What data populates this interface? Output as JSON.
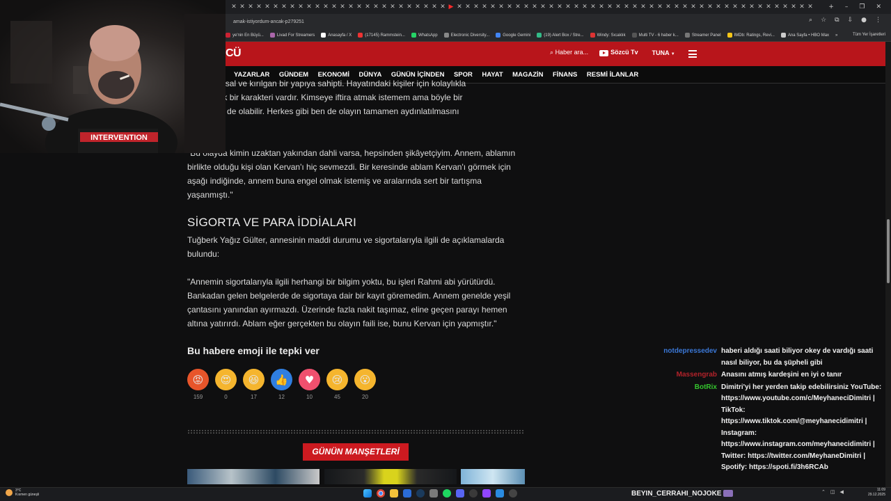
{
  "browser": {
    "url": "amak-istiyordum-ancak-p279251",
    "bookmarks": [
      {
        "label": "ye'nin En Büyü..."
      },
      {
        "label": "Livad For Streamers"
      },
      {
        "label": "Anasayfa / X"
      },
      {
        "label": "(17145) Rammstein..."
      },
      {
        "label": "WhatsApp"
      },
      {
        "label": "Electronic Diversity..."
      },
      {
        "label": "Google Gemini"
      },
      {
        "label": "(19) Alert Box / Stre..."
      },
      {
        "label": "Windy: Sıcaklık"
      },
      {
        "label": "Multi TV - 6 haber k..."
      },
      {
        "label": "Streamer Panel"
      },
      {
        "label": "IMDb: Ratings, Revi..."
      },
      {
        "label": "Ana Sayfa • HBO Max"
      }
    ],
    "bookmarks_more": "»",
    "all_bookmarks": "Tüm Yer İşaretleri",
    "new_tab": "+"
  },
  "site": {
    "logo": "CÜ",
    "search_placeholder": "Haber ara...",
    "tv_label": "Sözcü Tv",
    "user_label": "TUNA",
    "nav": [
      "YAZARLAR",
      "GÜNDEM",
      "EKONOMİ",
      "DÜNYA",
      "GÜNÜN İÇİNDEN",
      "SPOR",
      "HAYAT",
      "MAGAZİN",
      "FİNANS",
      "RESMİ İLANLAR"
    ]
  },
  "article": {
    "p1": "...duygusal ve kırılgan bir yapıya sahipti. Hayatındaki kişiler için kolaylıkla ...i girebilecek bir karakteri vardır. Kimseye iftira atmak istemem ama böyle bir ...bilecek biri de olabilir. Herkes gibi ben de olayın tamamen aydınlatılmasını",
    "p1_lines": [
      "duygusal ve kırılgan bir yapıya sahipti. Hayatındaki kişiler için kolaylıkla",
      "girebilecek bir karakteri vardır. Kimseye iftira atmak istemem ama böyle bir",
      "bilecek biri de olabilir. Herkes gibi ben de olayın tamamen aydınlatılmasını"
    ],
    "p2": "\"Bu olayda kimin uzaktan yakından dahli varsa, hepsinden şikâyetçiyim. Annem, ablamın birlikte olduğu kişi olan Kervan'ı hiç sevmezdi. Bir keresinde ablam Kervan'ı görmek için aşağı indiğinde, annem buna engel olmak istemiş ve aralarında sert bir tartışma yaşanmıştı.\"",
    "heading": "SİGORTA VE PARA İDDİALARI",
    "p3": "Tuğberk Yağız Gülter, annesinin maddi durumu ve sigortalarıyla ilgili de açıklamalarda bulundu:",
    "p4": "\"Annemin sigortalarıyla ilgili herhangi bir bilgim yoktu, bu işleri Rahmi abi yürütürdü. Bankadan gelen belgelerde de sigortaya dair bir kayıt göremedim. Annem genelde yeşil çantasını yanından ayırmazdı. Üzerinde fazla nakit taşımaz, eline geçen parayı hemen altına yatırırdı. Ablam eğer gerçekten bu olayın faili ise, bunu Kervan için yapmıştır.\""
  },
  "reactions": {
    "title": "Bu habere emoji ile tepki ver",
    "items": [
      {
        "name": "angry",
        "glyph": "😡",
        "count": "159",
        "color": "#e8552a"
      },
      {
        "name": "love-eyes",
        "glyph": "😍",
        "count": "0",
        "color": "#f5b52e"
      },
      {
        "name": "laughing",
        "glyph": "😆",
        "count": "17",
        "color": "#f5b52e"
      },
      {
        "name": "thumbs-up",
        "glyph": "👍",
        "count": "12",
        "color": "#2f7ee0"
      },
      {
        "name": "heart",
        "glyph": "♥",
        "count": "10",
        "color": "#f0506e"
      },
      {
        "name": "sad",
        "glyph": "😢",
        "count": "45",
        "color": "#f5b52e"
      },
      {
        "name": "surprised",
        "glyph": "😮",
        "count": "20",
        "color": "#f5b52e"
      }
    ]
  },
  "manset": "GÜNÜN MANŞETLERİ",
  "chat": [
    {
      "user": "notdepressedev",
      "color": "#3b78d8",
      "text": "haberi aldığı saati biliyor okey de vardığı saati nasıl biliyor, bu da şüpheli gibi"
    },
    {
      "user": "Massengrab",
      "color": "#b3222a",
      "text": "Anasını atmış kardeşini en iyi o tanır"
    },
    {
      "user": "BotRix",
      "color": "#35c52e",
      "text": "Dimitri'yi her yerden takip edebilirsiniz YouTube: https://www.youtube.com/c/MeyhaneciDimitri | TikTok: https://www.tiktok.com/@meyhanecidimitri | Instagram: https://www.instagram.com/meyhanecidimitri | Twitter: https://twitter.com/MeyhaneDimitri | Spotify: https://spoti.fi/3h6RCAb"
    }
  ],
  "taskbar": {
    "weather_temp": "3°C",
    "weather_desc": "Kısmen güneşli",
    "streamer": "BEYIN_CERRAHI_NOJOKE",
    "time": "11:09",
    "date": "29.12.2025"
  },
  "webcam": {
    "shirt_text": "INTERVENTION"
  }
}
